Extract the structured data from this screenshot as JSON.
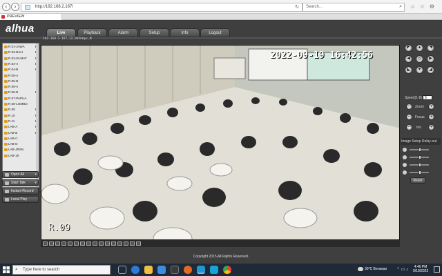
{
  "browser": {
    "url": "http://192.168.2.167/",
    "search_placeholder": "Search...",
    "tab_label": "PREVIEW"
  },
  "app": {
    "logo": "alhua",
    "nav": [
      "Live",
      "Playback",
      "Alarm",
      "Setup",
      "Info",
      "Logout"
    ],
    "active_tab": "Live"
  },
  "camera_list": [
    {
      "name": "R.01-JAWA",
      "flag": "M"
    },
    {
      "name": "R.02-BALI",
      "flag": "M"
    },
    {
      "name": "R.03-SUMAT",
      "flag": "M"
    },
    {
      "name": "R.04-A",
      "flag": "M"
    },
    {
      "name": "R.04-B",
      "flag": "M"
    },
    {
      "name": "R.05-A",
      "flag": ""
    },
    {
      "name": "R.05-B",
      "flag": ""
    },
    {
      "name": "R.06-A",
      "flag": ""
    },
    {
      "name": "R.06-B",
      "flag": "M"
    },
    {
      "name": "R.07-PAPUA",
      "flag": ""
    },
    {
      "name": "R.08-LOMBO",
      "flag": ""
    },
    {
      "name": "R.09",
      "flag": "M"
    },
    {
      "name": "R.10",
      "flag": "M"
    },
    {
      "name": "R.11",
      "flag": "M"
    },
    {
      "name": "LAB-A",
      "flag": "M"
    },
    {
      "name": "LAB-B",
      "flag": "M"
    },
    {
      "name": "LAB-C",
      "flag": ""
    },
    {
      "name": "LAB-D",
      "flag": ""
    },
    {
      "name": "LAB-JRSN",
      "flag": ""
    },
    {
      "name": "LAB-19",
      "flag": ""
    }
  ],
  "left_buttons": {
    "open_all": "Open All",
    "start_talk": "Start Talk",
    "instant_record": "Instant Record",
    "local_play": "Local Play"
  },
  "video": {
    "stream_title": "192.168.2.167_12_985kbps_M",
    "osd_timestamp": "2022-09-19  16:42:56",
    "osd_room": "R.09"
  },
  "ptz": {
    "speed_label": "Speed(1-8)",
    "speed_value": "5",
    "zoom_label": "Zoom",
    "focus_label": "Focus",
    "iris_label": "Iris",
    "image_setup_label": "Image Setup",
    "relay_out_label": "Relay-out",
    "reset_label": "Reset"
  },
  "footer": {
    "copyright": "Copyright 2015,All Rights Reserved."
  },
  "taskbar": {
    "search_placeholder": "Type here to search",
    "weather": "30°C  Berawan",
    "time": "4:46 PM",
    "date": "9/19/2022"
  }
}
